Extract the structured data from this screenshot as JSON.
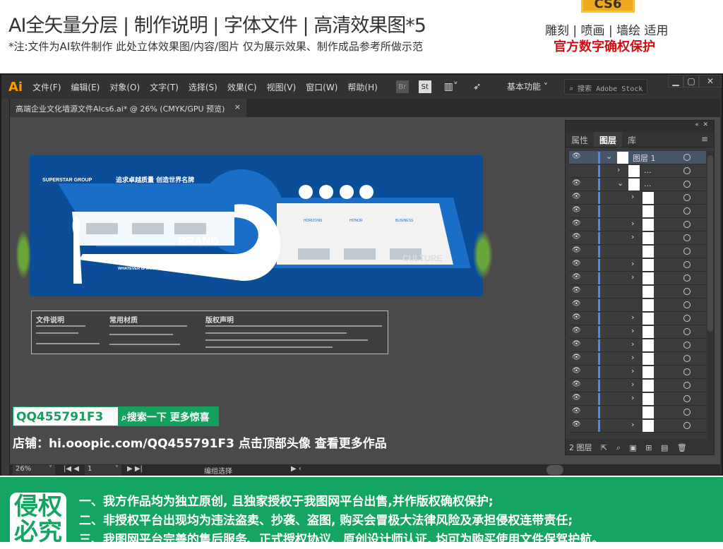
{
  "header": {
    "title": "AI全矢量分层 | 制作说明 | 字体文件 | 高清效果图*5",
    "note": "*注:文件为AI软件制作 此处立体效果图/内容/图片 仅为展示效果、制作成品参考所做示范",
    "version_badge": "CS6",
    "usage": "雕刻 | 喷画 | 墙绘 适用",
    "protection": "官方数字确权保护"
  },
  "app": {
    "logo": "Ai",
    "menu": [
      "文件(F)",
      "编辑(E)",
      "对象(O)",
      "文字(T)",
      "选择(S)",
      "效果(C)",
      "视图(V)",
      "窗口(W)",
      "帮助(H)"
    ],
    "toolbar_icons": [
      "Br",
      "St"
    ],
    "workspace": "基本功能",
    "search_placeholder": "搜索 Adobe Stock",
    "doc_tab": "高端企业文化墙源文件AIcs6.ai* @ 26% (CMYK/GPU 预览)",
    "doc_close": "×"
  },
  "artboard": {
    "brand_name": "SUPERSTAR GROUP",
    "slogan": "追求卓越质量 创造世界名牌",
    "brand_word": "BRAND",
    "culture_word": "CULTURE",
    "tagline": "WHATEVER IS WORTH DOING IS WORTH DOING WELL",
    "sections": [
      "HORIZONS",
      "HONOR",
      "BUSINESS"
    ],
    "info_headings": [
      "文件说明",
      "常用材质",
      "版权声明"
    ]
  },
  "promo": {
    "qq": "QQ455791F3",
    "search_button": "搜索一下 更多惊喜",
    "shop": "店铺：hi.ooopic.com/QQ455791F3   点击顶部头像 查看更多作品"
  },
  "layers_panel": {
    "tabs": [
      "属性",
      "图层",
      "库"
    ],
    "active_tab": "图层",
    "rows": [
      {
        "name": "图层 1",
        "visible": true,
        "chevron": "down",
        "level": 0,
        "selected": true
      },
      {
        "name": "...",
        "visible": false,
        "chevron": "right",
        "level": 1
      },
      {
        "name": "...",
        "visible": true,
        "chevron": "down",
        "level": 1
      },
      {
        "name": "",
        "visible": true,
        "chevron": "right",
        "level": 2
      },
      {
        "name": "",
        "visible": true,
        "chevron": "",
        "level": 2
      },
      {
        "name": "",
        "visible": true,
        "chevron": "right",
        "level": 2
      },
      {
        "name": "",
        "visible": true,
        "chevron": "right",
        "level": 2
      },
      {
        "name": "",
        "visible": true,
        "chevron": "",
        "level": 2
      },
      {
        "name": "",
        "visible": true,
        "chevron": "right",
        "level": 2
      },
      {
        "name": "",
        "visible": true,
        "chevron": "right",
        "level": 2
      },
      {
        "name": "",
        "visible": true,
        "chevron": "",
        "level": 2
      },
      {
        "name": "",
        "visible": true,
        "chevron": "",
        "level": 2
      },
      {
        "name": "",
        "visible": true,
        "chevron": "right",
        "level": 2
      },
      {
        "name": "",
        "visible": true,
        "chevron": "right",
        "level": 2
      },
      {
        "name": "",
        "visible": true,
        "chevron": "right",
        "level": 2
      },
      {
        "name": "",
        "visible": true,
        "chevron": "right",
        "level": 2
      },
      {
        "name": "",
        "visible": true,
        "chevron": "right",
        "level": 2
      },
      {
        "name": "",
        "visible": true,
        "chevron": "right",
        "level": 2
      },
      {
        "name": "",
        "visible": true,
        "chevron": "right",
        "level": 2
      },
      {
        "name": "",
        "visible": true,
        "chevron": "",
        "level": 2
      },
      {
        "name": "",
        "visible": true,
        "chevron": "right",
        "level": 2
      }
    ],
    "footer_count": "2 图层"
  },
  "statusbar": {
    "zoom": "26%",
    "page": "1",
    "tool": "编组选择"
  },
  "notice": {
    "badge": "侵权必究",
    "lines": [
      "一、我方作品均为独立原创, 且独家授权于我图网平台出售,并作版权确权保护;",
      "二、非授权平台出现均为违法盗卖、抄袭、盗图, 购买会冒极大法律风险及承担侵权连带责任;",
      "三、我图网平台完善的售后服务、正式授权协议、原创设计师认证, 均可为购买使用文件保驾护航。"
    ]
  },
  "colors": {
    "accent_orange": "#ff9a00",
    "brand_blue": "#1a6ec8",
    "wall_navy": "#0b4d96",
    "green": "#13a561",
    "red": "#d40d12"
  }
}
